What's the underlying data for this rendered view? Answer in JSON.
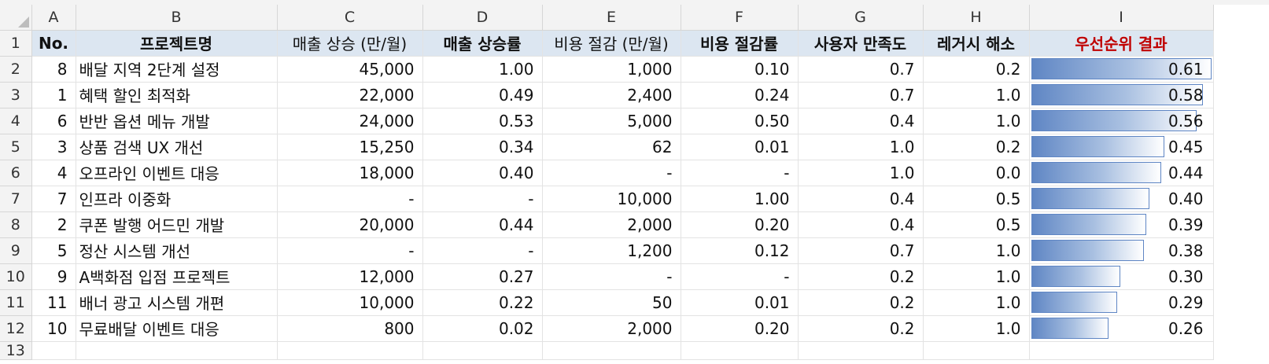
{
  "columns": [
    "A",
    "B",
    "C",
    "D",
    "E",
    "F",
    "G",
    "H",
    "I"
  ],
  "headers": {
    "no": "No.",
    "name": "프로젝트명",
    "rev_up": "매출 상승 (만/월)",
    "rev_rate": "매출 상승률",
    "cost_cut": "비용 절감 (만/월)",
    "cost_rate": "비용 절감률",
    "satisfaction": "사용자 만족도",
    "legacy": "레거시 해소",
    "priority": "우선순위 결과"
  },
  "row_numbers": [
    "1",
    "2",
    "3",
    "4",
    "5",
    "6",
    "7",
    "8",
    "9",
    "10",
    "11",
    "12",
    "13"
  ],
  "rows": [
    {
      "no": "8",
      "name": "배달 지역 2단계 설정",
      "rev_up": "45,000",
      "rev_rate": "1.00",
      "cost_cut": "1,000",
      "cost_rate": "0.10",
      "satisfaction": "0.7",
      "legacy": "0.2",
      "priority": "0.61",
      "priority_value": 0.61
    },
    {
      "no": "1",
      "name": "혜택 할인 최적화",
      "rev_up": "22,000",
      "rev_rate": "0.49",
      "cost_cut": "2,400",
      "cost_rate": "0.24",
      "satisfaction": "0.7",
      "legacy": "1.0",
      "priority": "0.58",
      "priority_value": 0.58
    },
    {
      "no": "6",
      "name": "반반 옵션 메뉴 개발",
      "rev_up": "24,000",
      "rev_rate": "0.53",
      "cost_cut": "5,000",
      "cost_rate": "0.50",
      "satisfaction": "0.4",
      "legacy": "1.0",
      "priority": "0.56",
      "priority_value": 0.56
    },
    {
      "no": "3",
      "name": "상품 검색 UX 개선",
      "rev_up": "15,250",
      "rev_rate": "0.34",
      "cost_cut": "62",
      "cost_rate": "0.01",
      "satisfaction": "1.0",
      "legacy": "0.2",
      "priority": "0.45",
      "priority_value": 0.45
    },
    {
      "no": "4",
      "name": "오프라인 이벤트 대응",
      "rev_up": "18,000",
      "rev_rate": "0.40",
      "cost_cut": "-",
      "cost_rate": "-",
      "satisfaction": "1.0",
      "legacy": "0.0",
      "priority": "0.44",
      "priority_value": 0.44
    },
    {
      "no": "7",
      "name": "인프라 이중화",
      "rev_up": "-",
      "rev_rate": "-",
      "cost_cut": "10,000",
      "cost_rate": "1.00",
      "satisfaction": "0.4",
      "legacy": "0.5",
      "priority": "0.40",
      "priority_value": 0.4
    },
    {
      "no": "2",
      "name": "쿠폰 발행 어드민 개발",
      "rev_up": "20,000",
      "rev_rate": "0.44",
      "cost_cut": "2,000",
      "cost_rate": "0.20",
      "satisfaction": "0.4",
      "legacy": "0.5",
      "priority": "0.39",
      "priority_value": 0.39
    },
    {
      "no": "5",
      "name": "정산 시스템 개선",
      "rev_up": "-",
      "rev_rate": "-",
      "cost_cut": "1,200",
      "cost_rate": "0.12",
      "satisfaction": "0.7",
      "legacy": "1.0",
      "priority": "0.38",
      "priority_value": 0.38
    },
    {
      "no": "9",
      "name": "A백화점 입점 프로젝트",
      "rev_up": "12,000",
      "rev_rate": "0.27",
      "cost_cut": "-",
      "cost_rate": "-",
      "satisfaction": "0.2",
      "legacy": "1.0",
      "priority": "0.30",
      "priority_value": 0.3
    },
    {
      "no": "11",
      "name": "배너 광고 시스템 개편",
      "rev_up": "10,000",
      "rev_rate": "0.22",
      "cost_cut": "50",
      "cost_rate": "0.01",
      "satisfaction": "0.2",
      "legacy": "1.0",
      "priority": "0.29",
      "priority_value": 0.29
    },
    {
      "no": "10",
      "name": "무료배달 이벤트 대응",
      "rev_up": "800",
      "rev_rate": "0.02",
      "cost_cut": "2,000",
      "cost_rate": "0.20",
      "satisfaction": "0.2",
      "legacy": "1.0",
      "priority": "0.26",
      "priority_value": 0.26
    }
  ],
  "colors": {
    "header_fill": "#dce6f1",
    "priority_header_text": "#c00000",
    "databar": "#5f86c4"
  }
}
